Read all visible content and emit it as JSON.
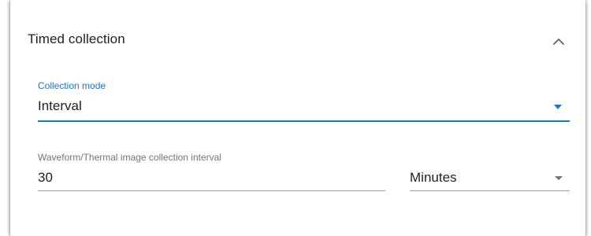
{
  "section": {
    "title": "Timed collection",
    "toggle_icon": "chevron-up-icon"
  },
  "collection_mode": {
    "label": "Collection mode",
    "value": "Interval",
    "dropdown_icon": "triangle-down-icon",
    "accent_color": "#1976d2"
  },
  "interval": {
    "label": "Waveform/Thermal image collection interval",
    "value": "30"
  },
  "unit": {
    "value": "Minutes",
    "dropdown_icon": "triangle-down-icon"
  }
}
